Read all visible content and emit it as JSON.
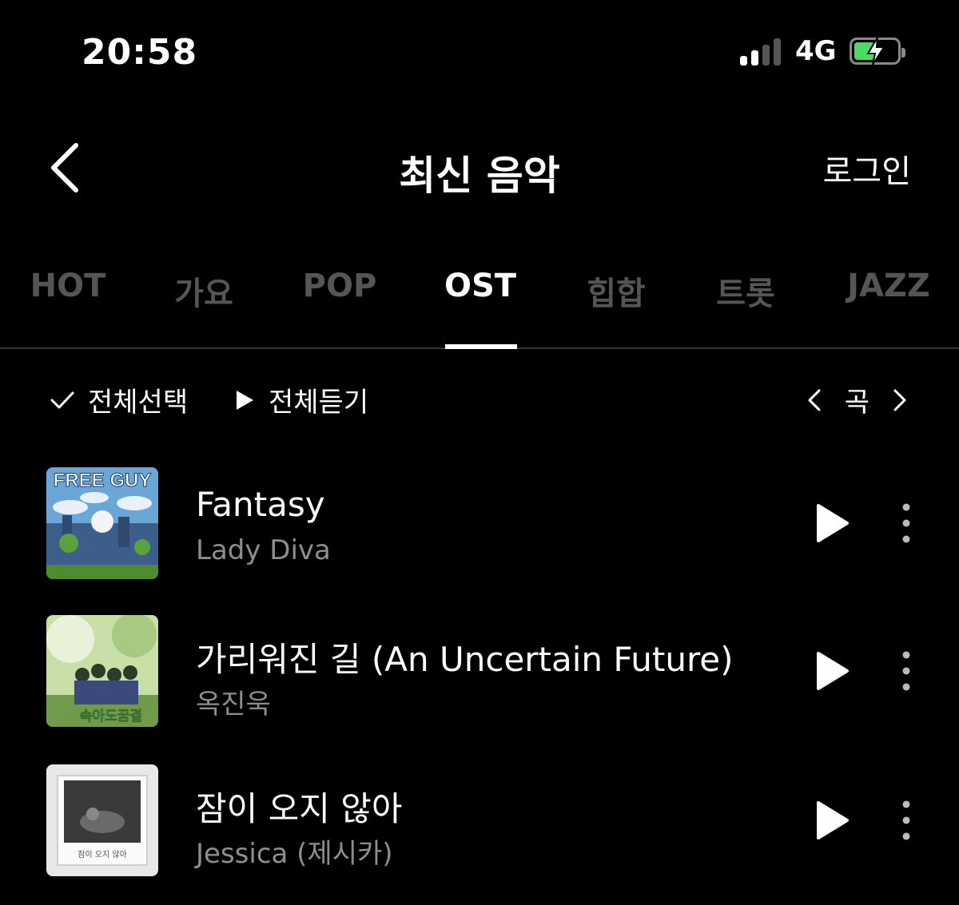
{
  "status_bar": {
    "time": "20:58",
    "network": "4G",
    "battery_color": "#4cd964",
    "signal_bars_filled": 2
  },
  "header": {
    "title": "최신 음악",
    "login_label": "로그인"
  },
  "tabs": [
    {
      "label": "HOT",
      "active": false
    },
    {
      "label": "가요",
      "active": false
    },
    {
      "label": "POP",
      "active": false
    },
    {
      "label": "OST",
      "active": true
    },
    {
      "label": "힙합",
      "active": false
    },
    {
      "label": "트롯",
      "active": false
    },
    {
      "label": "JAZZ",
      "active": false
    }
  ],
  "controls": {
    "select_all_label": "전체선택",
    "play_all_label": "전체듣기",
    "pager_label": "곡"
  },
  "songs": [
    {
      "title": "Fantasy",
      "artist": "Lady Diva",
      "cover_text": "FREE GUY"
    },
    {
      "title": "가리워진 길 (An Uncertain Future)",
      "artist": "옥진욱",
      "cover_text": "속아도꿈결"
    },
    {
      "title": "잠이 오지 않아",
      "artist": "Jessica (제시카)",
      "cover_text": "잠이 오지 않아"
    }
  ],
  "colors": {
    "background": "#000000",
    "active_text": "#ffffff",
    "inactive_tab": "#555555",
    "secondary_text": "#8e8e8e"
  }
}
